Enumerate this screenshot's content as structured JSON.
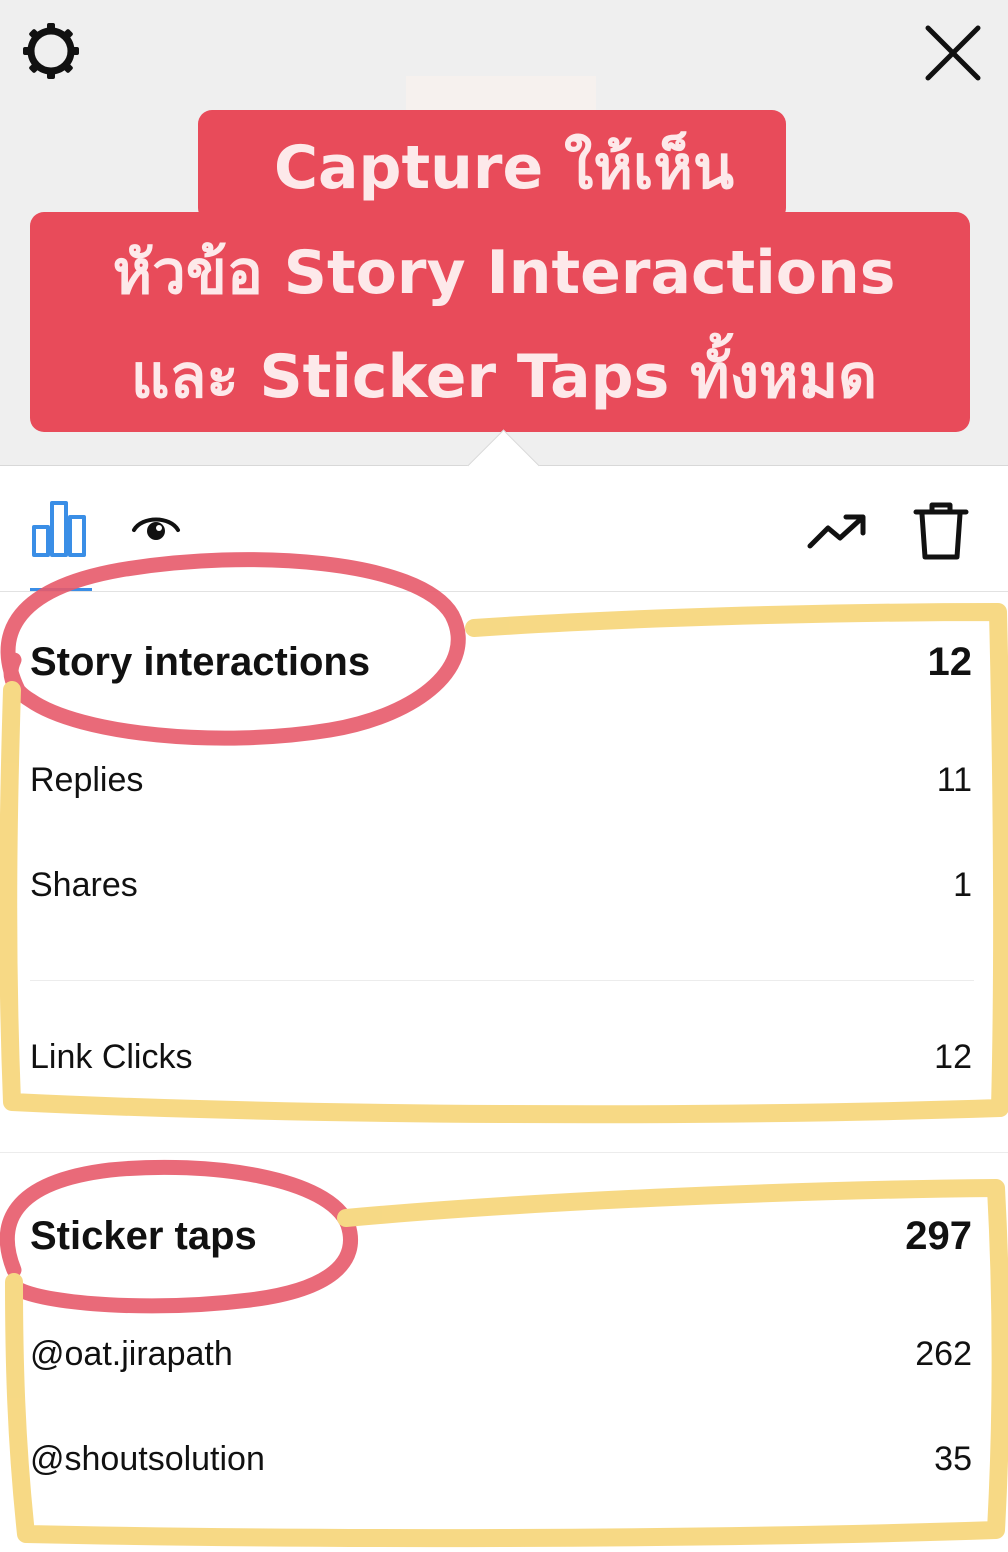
{
  "header": {
    "settings_icon": "gear-icon",
    "close_icon": "close-icon",
    "caption": {
      "line1": "Capture ให้เห็น",
      "line2": "หัวข้อ Story Interactions",
      "line3": "และ Sticker Taps ทั้งหมด",
      "background_color": "#e84b5a",
      "text_color": "#fde9ea"
    }
  },
  "toolbar": {
    "tabs": [
      {
        "icon": "bar-chart-icon",
        "active": true,
        "accent": "#3a8ee6"
      },
      {
        "icon": "eye-icon",
        "active": false
      }
    ],
    "actions": [
      {
        "icon": "trending-up-icon"
      },
      {
        "icon": "trash-icon"
      }
    ]
  },
  "story_interactions": {
    "title": "Story interactions",
    "total": "12",
    "items": [
      {
        "label": "Replies",
        "value": "11"
      },
      {
        "label": "Shares",
        "value": "1"
      },
      {
        "label": "Link Clicks",
        "value": "12"
      }
    ]
  },
  "sticker_taps": {
    "title": "Sticker taps",
    "total": "297",
    "items": [
      {
        "label": "@oat.jirapath",
        "value": "262"
      },
      {
        "label": "@shoutsolution",
        "value": "35"
      }
    ]
  },
  "annotations": {
    "circle_color": "#e75a6b",
    "box_color": "#f6d578"
  }
}
